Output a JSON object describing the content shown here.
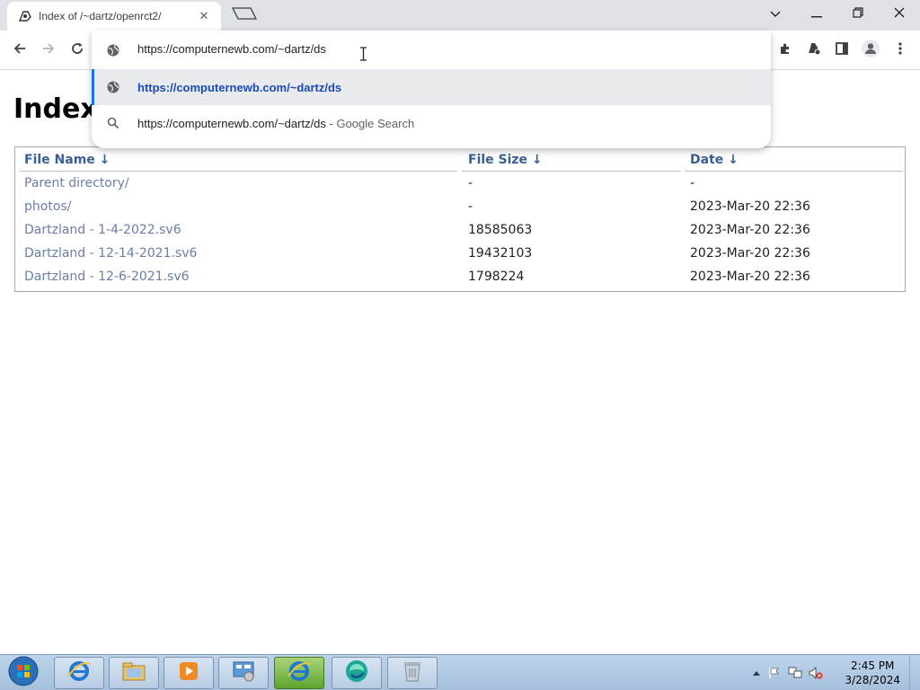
{
  "browser": {
    "tab": {
      "title": "Index of /~dartz/openrct2/",
      "favicon": "openrct2-icon",
      "close_glyph": "✕"
    },
    "new_tab_icon": "new-tab-icon",
    "window_controls": [
      "chevron-down-icon",
      "minimize-icon",
      "restore-icon",
      "close-icon"
    ],
    "toolbar": {
      "icons": [
        "back-icon",
        "forward-icon",
        "reload-icon",
        "extensions-icon",
        "extension-puzzle-icon",
        "side-panel-icon",
        "profile-icon",
        "menu-icon"
      ]
    },
    "omnibox": {
      "input_value": "https://computernewb.com/~dartz/ds",
      "suggestions": [
        {
          "text": "https://computernewb.com/~dartz/ds",
          "kind": "url",
          "icon": "globe-icon",
          "selected": true
        },
        {
          "text": "https://computernewb.com/~dartz/ds",
          "separator": " - ",
          "suffix": "Google Search",
          "kind": "search",
          "icon": "search-icon",
          "selected": false
        }
      ]
    }
  },
  "page": {
    "title": "Index",
    "table": {
      "headers": [
        "File Name  ↓",
        "File Size  ↓",
        "Date  ↓"
      ],
      "rows": [
        [
          "Parent directory/",
          "-",
          "-"
        ],
        [
          "photos/",
          "-",
          "2023-Mar-20 22:36"
        ],
        [
          "Dartzland - 1-4-2022.sv6",
          "18585063",
          "2023-Mar-20 22:36"
        ],
        [
          "Dartzland - 12-14-2021.sv6",
          "19432103",
          "2023-Mar-20 22:36"
        ],
        [
          "Dartzland - 12-6-2021.sv6",
          "1798224",
          "2023-Mar-20 22:36"
        ]
      ]
    }
  },
  "taskbar": {
    "items": [
      "internet-explorer-icon",
      "windows-explorer-icon",
      "media-player-icon",
      "control-panel-icon",
      "internet-explorer-icon",
      "browser-icon",
      "recycle-bin-icon"
    ],
    "active_index": 4,
    "clock": {
      "time": "2:45 PM",
      "date": "3/28/2024"
    }
  },
  "colors": {
    "link": "#6a7ea4",
    "header": "#3a5f94",
    "accent": "#1a73e8"
  }
}
